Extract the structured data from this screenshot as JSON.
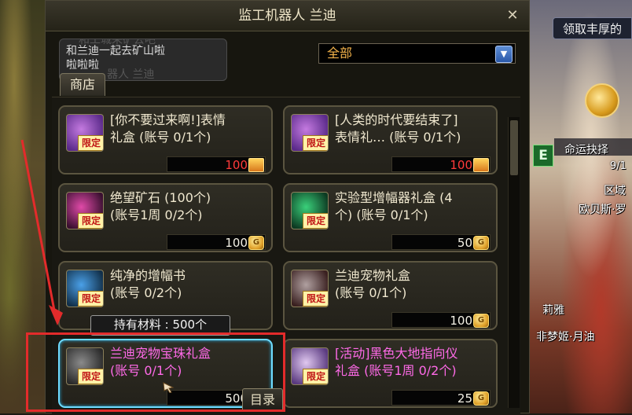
{
  "window": {
    "title": "监工机器人 兰迪",
    "close_glyph": "✕"
  },
  "npc": {
    "dialog": "和兰迪一起去矿山啦\n啦啦啦",
    "dialog_ghost_top": "和工城采矿去吧",
    "dialog_ghost_bottom": "器人 兰迪"
  },
  "tabs": {
    "shop_label": "商店"
  },
  "filter": {
    "selected": "全部",
    "caret": "▼"
  },
  "items": [
    {
      "name": "[你不要过来啊!]表情\n礼盒    (账号 0/1个)",
      "badge": "限定",
      "price": "100",
      "price_color": "#ff3a3a",
      "currency_icon": "gift-box-icon",
      "name_color": "#f0e8cf",
      "icon_colors": [
        "#c47ae0",
        "#5a2a8a"
      ]
    },
    {
      "name": "[人类的时代要结束了]\n表情礼… (账号 0/1个)",
      "badge": "限定",
      "price": "100",
      "price_color": "#ff3a3a",
      "currency_icon": "gift-box-icon",
      "name_color": "#f0e8cf",
      "icon_colors": [
        "#c47ae0",
        "#5a2a8a"
      ]
    },
    {
      "name": "绝望矿石 (100个)\n    (账号1周 0/2个)",
      "badge": "限定",
      "price": "100",
      "price_color": "#f4f1e6",
      "currency_icon": "gold-coin-icon",
      "name_color": "#f0e8cf",
      "icon_colors": [
        "#e04aa8",
        "#3a1030"
      ]
    },
    {
      "name": "实验型增幅器礼盒 (4\n个)  (账号 0/1个)",
      "badge": "限定",
      "price": "50",
      "price_color": "#f4f1e6",
      "currency_icon": "gold-coin-icon",
      "name_color": "#f0e8cf",
      "icon_colors": [
        "#3ad07a",
        "#0d3a22"
      ]
    },
    {
      "name": "纯净的增幅书\n    (账号 0/2个)",
      "badge": "限定",
      "price": "",
      "price_color": "#f4f1e6",
      "currency_icon": "",
      "name_color": "#f0e8cf",
      "icon_colors": [
        "#4aa0e8",
        "#12304a"
      ]
    },
    {
      "name": "兰迪宠物礼盒\n        (账号 0/1个)",
      "badge": "限定",
      "price": "100",
      "price_color": "#f4f1e6",
      "currency_icon": "gold-coin-icon",
      "name_color": "#f0e8cf",
      "icon_colors": [
        "#b0a0a0",
        "#3a2020"
      ]
    },
    {
      "name": "兰迪宠物宝珠礼盒\n    (账号 0/1个)",
      "badge": "限定",
      "price": "500",
      "price_color": "#f4f1e6",
      "currency_icon": "gold-coin-icon",
      "name_color": "#ff6ae8",
      "icon_colors": [
        "#8a8a8a",
        "#2a2a2a"
      ]
    },
    {
      "name": "[活动]黑色大地指向仪\n礼盒 (账号1周 0/2个)",
      "badge": "限定",
      "price": "25",
      "price_color": "#f4f1e6",
      "currency_icon": "gold-coin-icon",
      "name_color": "#ff6ae8",
      "icon_colors": [
        "#e0c8f0",
        "#5a3a80"
      ]
    }
  ],
  "tooltip": "持有材料 : 500个",
  "catalog_button": "目录",
  "overlay": {
    "banner": "领取丰厚的",
    "e_badge": "E",
    "fate": "命运抉择",
    "fate_count": "9/1",
    "region": "区域",
    "name_line": "欧贝斯·罗",
    "name_line2": "莉雅",
    "name_line3": "非梦姬·月油"
  }
}
